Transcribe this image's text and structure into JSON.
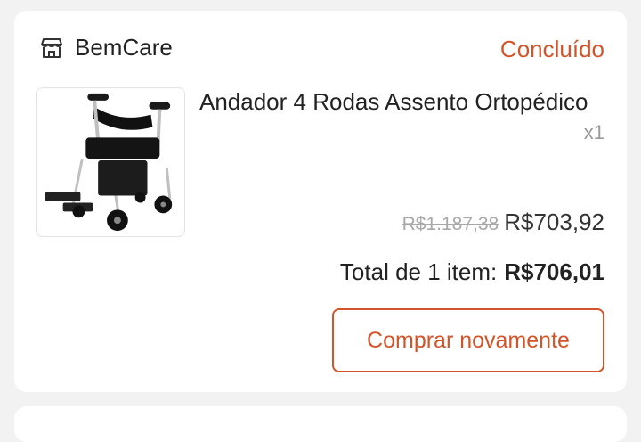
{
  "order": {
    "shop": {
      "name": "BemCare",
      "icon": "store-icon"
    },
    "status": "Concluído",
    "status_color": "#d4542a",
    "product": {
      "name": "Andador 4 Rodas Assento Ortopédico",
      "quantity": "x1",
      "original_price": "R$1.187,38",
      "price": "R$703,92",
      "image_icon": "rollator-walker-image"
    },
    "total_label": "Total de 1 item:",
    "total_value": "R$706,01",
    "rebuy_label": "Comprar novamente"
  }
}
